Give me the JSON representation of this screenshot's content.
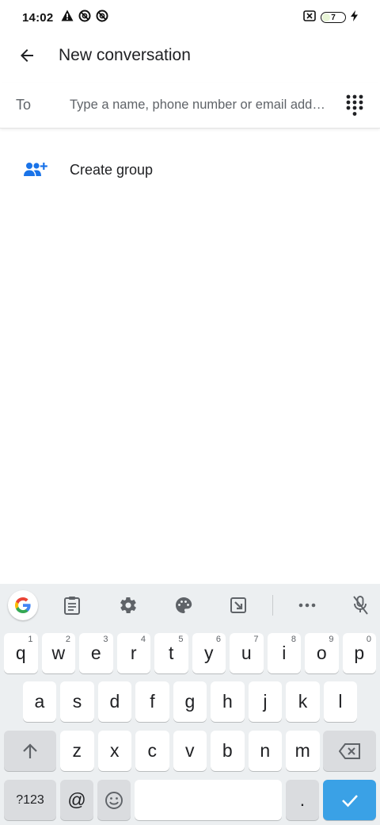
{
  "status_bar": {
    "time": "14:02",
    "left_icons": [
      "warning-icon",
      "sync-off-icon",
      "sync-off-icon"
    ],
    "right_icons": [
      "no-sim-icon",
      "battery-icon",
      "charging-bolt-icon"
    ],
    "battery_level": "7"
  },
  "app_bar": {
    "back_icon": "arrow-back-icon",
    "title": "New conversation"
  },
  "recipient": {
    "label": "To",
    "placeholder": "Type a name, phone number or email add…",
    "value": "",
    "dialpad_icon": "dialpad-icon"
  },
  "create_group": {
    "icon": "group-add-icon",
    "label": "Create group"
  },
  "keyboard": {
    "toolbar": [
      "google-icon",
      "clipboard-icon",
      "settings-gear-icon",
      "palette-icon",
      "resize-icon",
      "more-dots-icon",
      "mic-off-icon"
    ],
    "row1": [
      {
        "label": "q",
        "hint": "1"
      },
      {
        "label": "w",
        "hint": "2"
      },
      {
        "label": "e",
        "hint": "3"
      },
      {
        "label": "r",
        "hint": "4"
      },
      {
        "label": "t",
        "hint": "5"
      },
      {
        "label": "y",
        "hint": "6"
      },
      {
        "label": "u",
        "hint": "7"
      },
      {
        "label": "i",
        "hint": "8"
      },
      {
        "label": "o",
        "hint": "9"
      },
      {
        "label": "p",
        "hint": "0"
      }
    ],
    "row2": [
      "a",
      "s",
      "d",
      "f",
      "g",
      "h",
      "j",
      "k",
      "l"
    ],
    "row3": [
      "z",
      "x",
      "c",
      "v",
      "b",
      "n",
      "m"
    ],
    "shift_icon": "shift-arrow-up-icon",
    "backspace_icon": "backspace-icon",
    "symbols_label": "?123",
    "at_label": "@",
    "emoji_icon": "emoji-icon",
    "period_label": ".",
    "enter_icon": "checkmark-icon",
    "colors": {
      "keyboard_bg": "#eceff1",
      "enter_key": "#3aa1e6",
      "accent_blue": "#1a73e8"
    }
  }
}
